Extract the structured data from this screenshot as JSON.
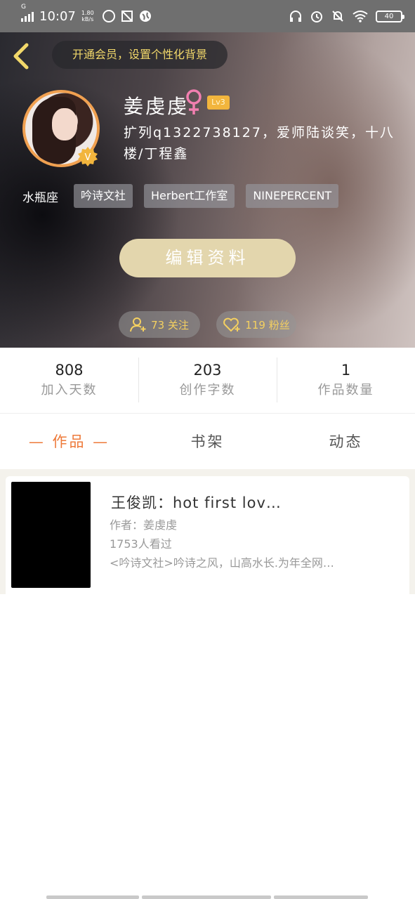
{
  "status_bar": {
    "carrier": "G",
    "time": "10:07",
    "net_speed_value": "1.80",
    "net_speed_unit": "kB/s",
    "battery": "40",
    "icons": [
      "signal-icon",
      "nfc-icon",
      "screenshot-icon",
      "vpn-icon",
      "headphone-icon",
      "alarm-icon",
      "mute-icon",
      "wifi-icon",
      "battery-icon"
    ]
  },
  "header": {
    "vip_banner": "开通会员，设置个性化背景",
    "username": "姜虔虔",
    "gender": "♀",
    "level": "Lv3",
    "verified_badge": "V",
    "bio": "扩列q1322738127，爱师陆谈笑，十八楼/丁程鑫",
    "zodiac": "水瓶座",
    "tags": [
      "吟诗文社",
      "Herbert工作室",
      "NINEPERCENT"
    ],
    "edit_button": "编辑资料",
    "following": "73 关注",
    "followers": "119 粉丝",
    "accent_color": "#f4d060"
  },
  "stats": [
    {
      "value": "808",
      "label": "加入天数"
    },
    {
      "value": "203",
      "label": "创作字数"
    },
    {
      "value": "1",
      "label": "作品数量"
    }
  ],
  "tabs": [
    {
      "label": "— 作品 —",
      "active": true
    },
    {
      "label": "书架",
      "active": false
    },
    {
      "label": "动态",
      "active": false
    }
  ],
  "works": [
    {
      "title": "王俊凯：hot first lov…",
      "author": "作者：姜虔虔",
      "views": "1753人看过",
      "description": "<吟诗文社>吟诗之风，山高水长.为年全网…"
    }
  ]
}
